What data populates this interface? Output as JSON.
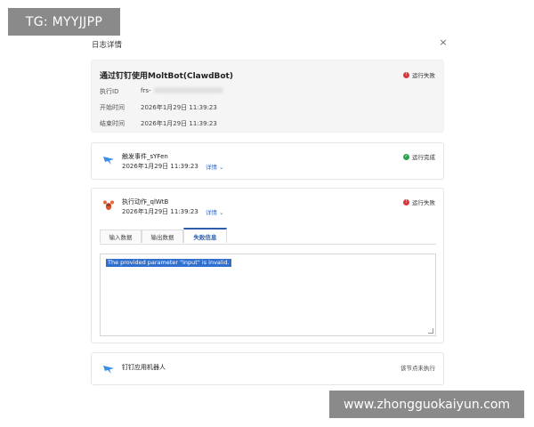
{
  "watermarks": {
    "top_left": "TG: MYYJJPP",
    "bottom_right": "www.zhongguokaiyun.com"
  },
  "dialog": {
    "title": "日志详情",
    "close_glyph": "×"
  },
  "summary": {
    "title": "通过钉钉使用MoltBot(ClawdBot)",
    "status": "运行失败",
    "rows": [
      {
        "label": "执行ID",
        "value": "frs-"
      },
      {
        "label": "开始时间",
        "value": "2026年1月29日 11:39:23"
      },
      {
        "label": "结束时间",
        "value": "2026年1月29日 11:39:23"
      }
    ]
  },
  "nodes": [
    {
      "name": "触发事件_sYFen",
      "time": "2026年1月29日 11:39:23",
      "detail_link": "详情 ⌄",
      "status": "运行完成"
    },
    {
      "name": "执行动作_qlWtB",
      "time": "2026年1月29日 11:39:23",
      "detail_link": "详情 ⌄",
      "status": "运行失败",
      "tabs": [
        "输入数据",
        "输出数据",
        "失败信息"
      ],
      "error_message": "The provided parameter \"input\" is invalid."
    },
    {
      "name": "钉钉应用机器人",
      "status_text": "该节点未执行"
    }
  ],
  "colors": {
    "fail": "#d9363e",
    "success": "#2ba34a",
    "link": "#3b6fc4",
    "active_tab": "#2d5ea8",
    "selection": "#2f6fd0"
  }
}
